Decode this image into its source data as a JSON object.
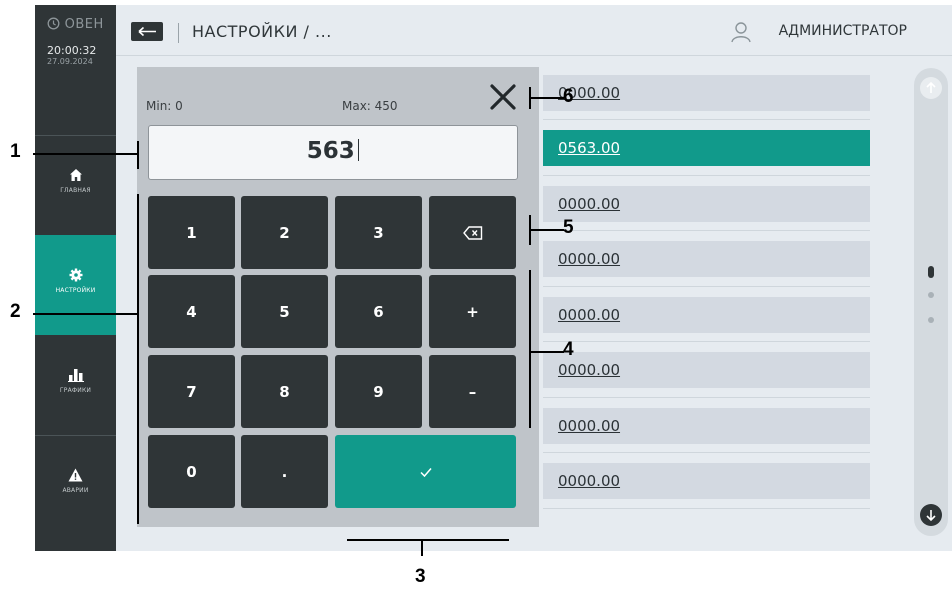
{
  "sidebar": {
    "logo": "ОВЕН",
    "time": "20:00:32",
    "date": "27.09.2024",
    "items": [
      {
        "label": "ГЛАВНАЯ",
        "icon": "home-icon",
        "active": false
      },
      {
        "label": "НАСТРОЙКИ",
        "icon": "gear-icon",
        "active": true
      },
      {
        "label": "ГРАФИКИ",
        "icon": "bar-chart-icon",
        "active": false
      },
      {
        "label": "АВАРИИ",
        "icon": "warning-icon",
        "active": false
      }
    ]
  },
  "header": {
    "breadcrumb": "НАСТРОЙКИ / ...",
    "user": "АДМИНИСТРАТОР"
  },
  "fields": [
    {
      "value": "0000.00",
      "active": false
    },
    {
      "value": "0563.00",
      "active": true
    },
    {
      "value": "0000.00",
      "active": false
    },
    {
      "value": "0000.00",
      "active": false
    },
    {
      "value": "0000.00",
      "active": false
    },
    {
      "value": "0000.00",
      "active": false
    },
    {
      "value": "0000.00",
      "active": false
    },
    {
      "value": "0000.00",
      "active": false
    }
  ],
  "keypad": {
    "min_label": "Min: 0",
    "max_label": "Max: 450",
    "input_value": "563",
    "keys": {
      "k1": "1",
      "k2": "2",
      "k3": "3",
      "k4": "4",
      "k5": "5",
      "k6": "6",
      "k7": "7",
      "k8": "8",
      "k9": "9",
      "k0": "0",
      "kdot": ".",
      "plus": "+",
      "minus": "–"
    }
  },
  "callouts": [
    "1",
    "2",
    "3",
    "4",
    "5",
    "6"
  ],
  "colors": {
    "accent": "#119a8b",
    "dark": "#2f3537",
    "panel": "#bfc4c9",
    "background": "#e6ebf0"
  }
}
